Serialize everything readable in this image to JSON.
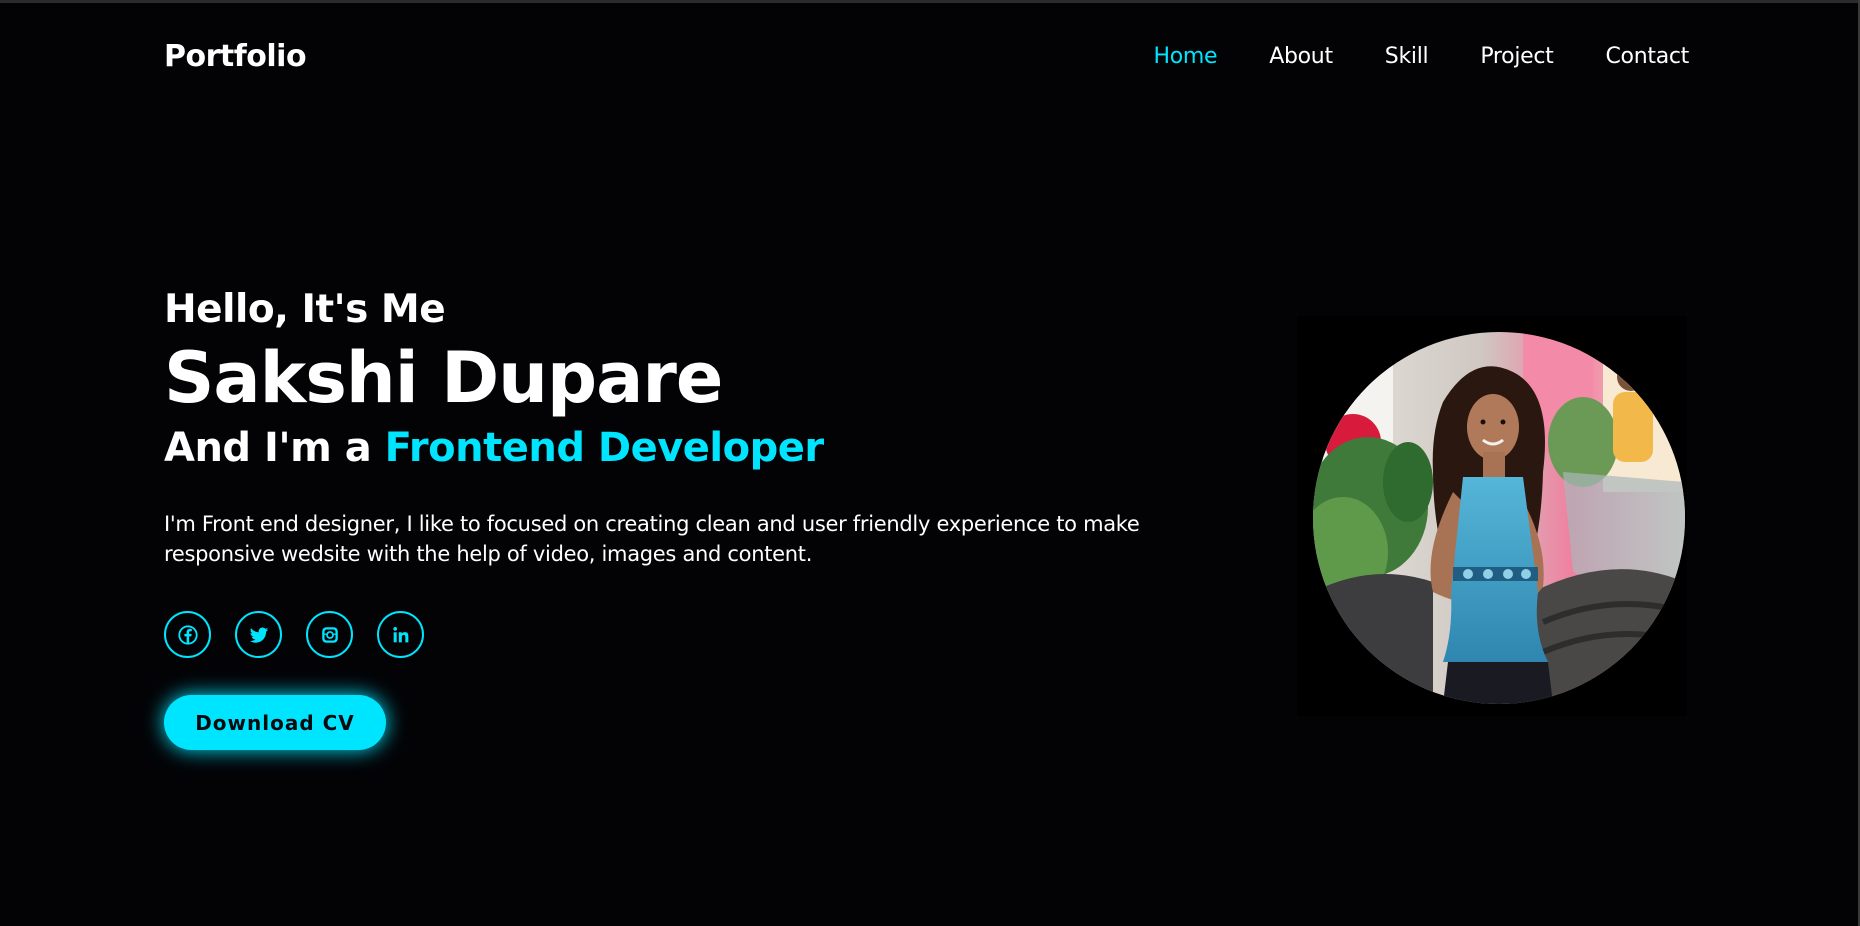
{
  "header": {
    "logo": "Portfolio",
    "nav": [
      {
        "label": "Home",
        "active": true
      },
      {
        "label": "About",
        "active": false
      },
      {
        "label": "Skill",
        "active": false
      },
      {
        "label": "Project",
        "active": false
      },
      {
        "label": "Contact",
        "active": false
      }
    ]
  },
  "hero": {
    "greeting": "Hello, It's Me",
    "name": "Sakshi Dupare",
    "role_prefix": "And I'm a ",
    "role_highlight": "Frontend Developer",
    "description": "I'm Front end designer, I like to focused on creating clean and user friendly experience to make responsive wedsite with the help of video, images and content.",
    "socials": [
      {
        "name": "facebook-icon"
      },
      {
        "name": "twitter-icon"
      },
      {
        "name": "instagram-icon"
      },
      {
        "name": "linkedin-icon"
      }
    ],
    "button_label": "Download CV"
  },
  "colors": {
    "accent": "#00e5ff",
    "background": "#030306",
    "text": "#ffffff"
  }
}
